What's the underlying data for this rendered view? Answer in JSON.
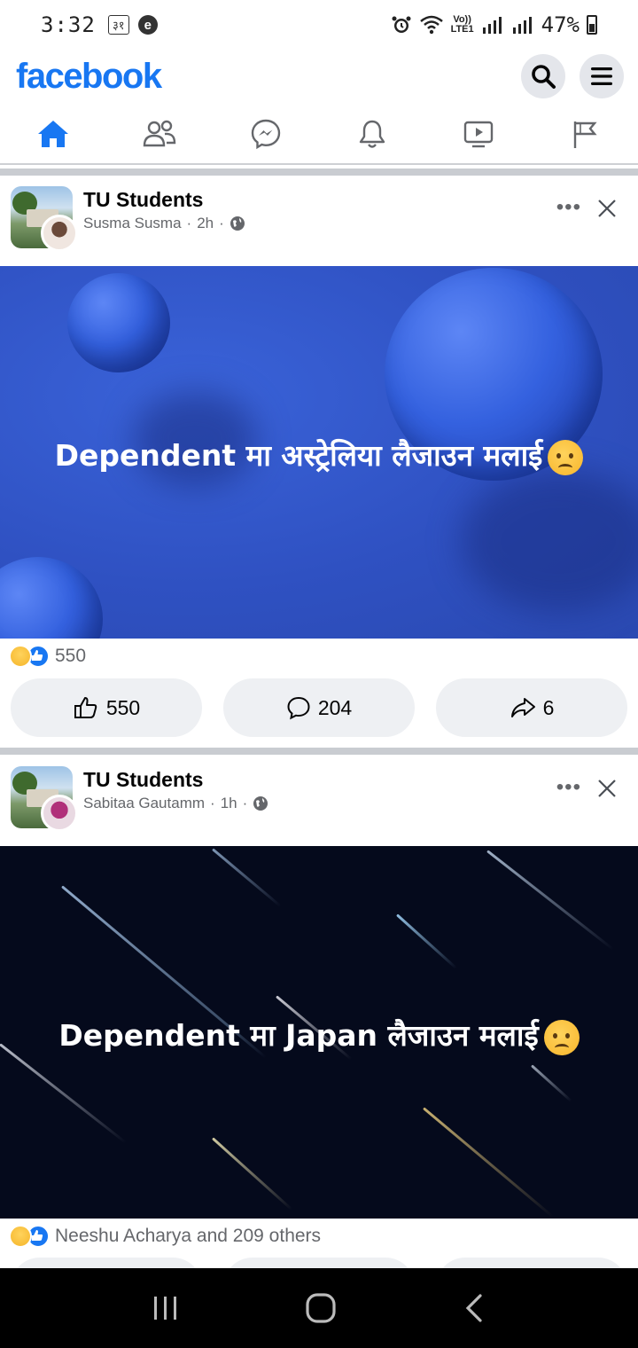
{
  "status_bar": {
    "time": "3:32",
    "badge": "३१",
    "e_icon": "e",
    "volte_top": "Vo))",
    "volte_bottom": "LTE1",
    "battery_percent": "47%"
  },
  "header": {
    "logo": "facebook",
    "search_icon": "search-icon",
    "menu_icon": "menu-icon"
  },
  "nav": {
    "tabs": [
      {
        "name": "home-icon",
        "active": true
      },
      {
        "name": "friends-icon",
        "active": false
      },
      {
        "name": "messenger-icon",
        "active": false
      },
      {
        "name": "bell-icon",
        "active": false
      },
      {
        "name": "video-icon",
        "active": false
      },
      {
        "name": "flag-icon",
        "active": false
      }
    ],
    "active_color": "#1877f2"
  },
  "posts": [
    {
      "group": "TU Students",
      "author": "Susma Susma",
      "time": "2h",
      "text": "Dependent मा अस्ट्रेलिया लैजाउन मलाई",
      "reaction_summary": "550",
      "like_count": "550",
      "comment_count": "204",
      "share_count": "6"
    },
    {
      "group": "TU Students",
      "author": "Sabitaa Gautamm",
      "time": "1h",
      "text": "Dependent मा Japan लैजाउन मलाई",
      "reaction_summary": "Neeshu Acharya and 209 others"
    }
  ],
  "colors": {
    "brand": "#1877f2",
    "meta_gray": "#65676b",
    "button_bg": "#eef0f3"
  }
}
